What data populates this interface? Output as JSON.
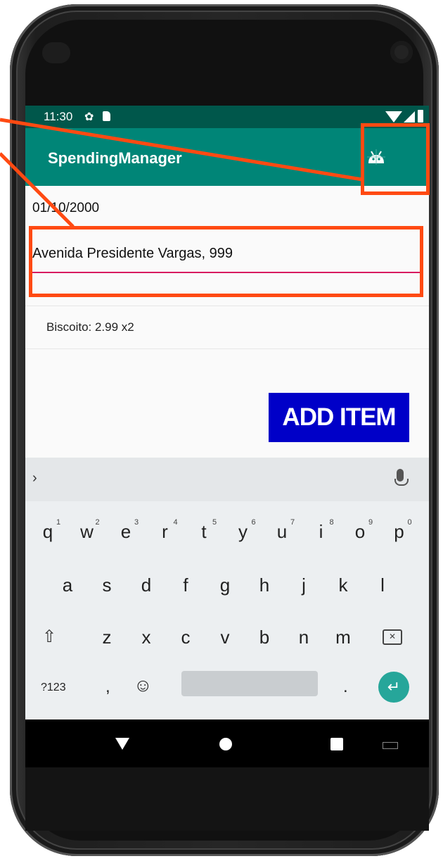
{
  "status_bar": {
    "time": "11:30",
    "icons": [
      "gear-icon",
      "sd-card-icon",
      "wifi-icon",
      "signal-icon",
      "battery-icon"
    ]
  },
  "app_bar": {
    "title": "SpendingManager",
    "action_icon": "android-bug-icon"
  },
  "form": {
    "date": "01/10/2000",
    "address_value": "Avenida Presidente Vargas, 999"
  },
  "items": [
    {
      "text": "Biscoito: 2.99 x2"
    }
  ],
  "add_button": {
    "label": "ADD ITEM"
  },
  "keyboard": {
    "row1": [
      {
        "key": "q",
        "hint": "1"
      },
      {
        "key": "w",
        "hint": "2"
      },
      {
        "key": "e",
        "hint": "3"
      },
      {
        "key": "r",
        "hint": "4"
      },
      {
        "key": "t",
        "hint": "5"
      },
      {
        "key": "y",
        "hint": "6"
      },
      {
        "key": "u",
        "hint": "7"
      },
      {
        "key": "i",
        "hint": "8"
      },
      {
        "key": "o",
        "hint": "9"
      },
      {
        "key": "p",
        "hint": "0"
      }
    ],
    "row2": [
      "a",
      "s",
      "d",
      "f",
      "g",
      "h",
      "j",
      "k",
      "l"
    ],
    "row3": [
      "z",
      "x",
      "c",
      "v",
      "b",
      "n",
      "m"
    ],
    "symbols_label": "?123",
    "comma": ",",
    "period": ".",
    "chevron": "›",
    "shift_glyph": "⇧",
    "enter_glyph": "↵"
  },
  "colors": {
    "status_bar": "#00574b",
    "app_bar": "#008577",
    "add_button": "#0000c8",
    "field_underline": "#d81b60",
    "annotation": "#ff4a12",
    "enter_key": "#26a69a"
  }
}
